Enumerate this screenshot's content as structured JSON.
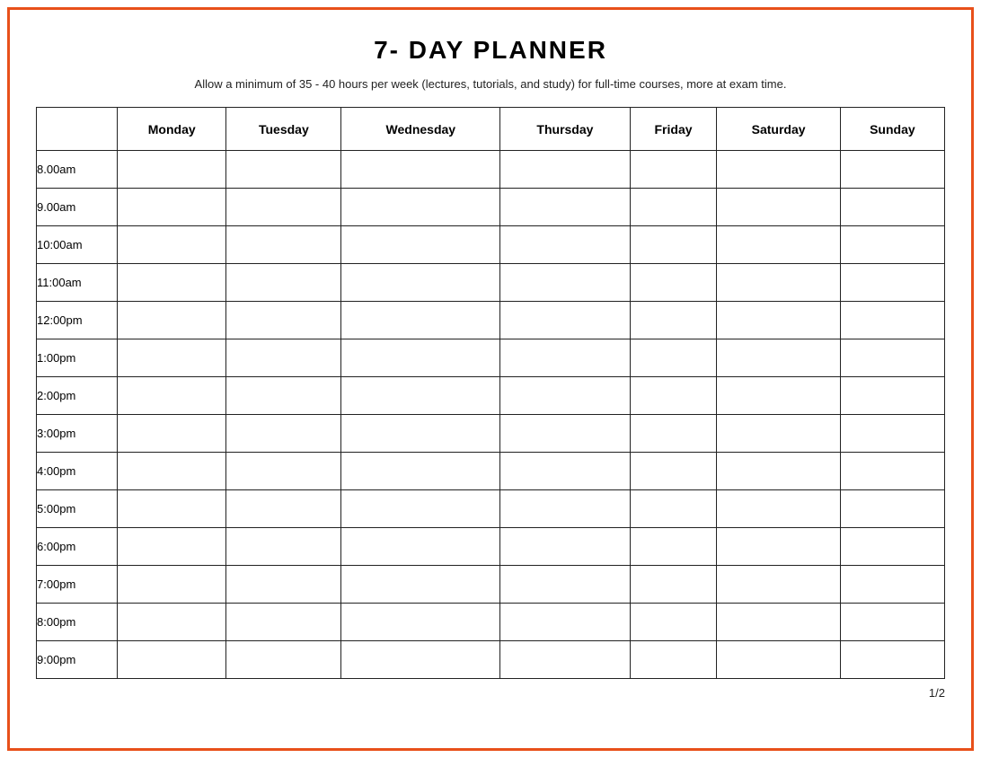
{
  "title": "7- DAY PLANNER",
  "subtitle": "Allow a minimum of 35 - 40 hours per week (lectures, tutorials, and study) for full-time courses, more at exam time.",
  "page_number": "1/2",
  "days": [
    "Monday",
    "Tuesday",
    "Wednesday",
    "Thursday",
    "Friday",
    "Saturday",
    "Sunday"
  ],
  "time_slots": [
    "8.00am",
    "9.00am",
    "10:00am",
    "11:00am",
    "12:00pm",
    "1:00pm",
    "2:00pm",
    "3:00pm",
    "4:00pm",
    "5:00pm",
    "6:00pm",
    "7:00pm",
    "8:00pm",
    "9:00pm"
  ]
}
